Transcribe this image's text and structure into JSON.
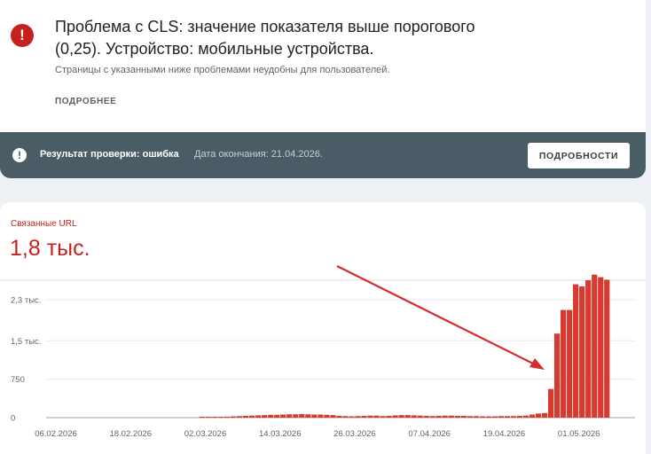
{
  "issue": {
    "title": "Проблема с CLS: значение показателя выше порогового (0,25). Устройство: мобильные устройства.",
    "description": "Страницы с указанными ниже проблемами неудобны для пользователей.",
    "more_link": "ПОДРОБНЕЕ",
    "icon": "error-icon"
  },
  "status": {
    "result": "Результат проверки: ошибка",
    "end_date": "Дата окончания: 21.04.2026.",
    "details_button": "ПОДРОБНОСТИ",
    "icon": "info-icon"
  },
  "metric": {
    "label": "Связанные URL",
    "value": "1,8 тыс."
  },
  "colors": {
    "accent": "#c5221f",
    "bar": "#d93a2f",
    "status_bar": "#4a5d66"
  },
  "chart_data": {
    "type": "bar",
    "title": "",
    "xlabel": "",
    "ylabel": "",
    "ylim": [
      0,
      2300
    ],
    "yticks": [
      0,
      750,
      1500,
      2300
    ],
    "ytick_labels": [
      "0",
      "750",
      "1,5 тыс.",
      "2,3 тыс."
    ],
    "x_start": "2026-02-06",
    "x_end": "2026-05-09",
    "xtick_labels": [
      "06.02.2026",
      "18.02.2026",
      "02.03.2026",
      "14.03.2026",
      "26.03.2026",
      "07.04.2026",
      "19.04.2026",
      "01.05.2026"
    ],
    "grid": true,
    "annotation": "red arrow pointing to spike",
    "series": [
      {
        "values": [
          {
            "x": "2026-02-06",
            "y": 0
          },
          {
            "x": "2026-02-07",
            "y": 0
          },
          {
            "x": "2026-02-08",
            "y": 0
          },
          {
            "x": "2026-02-09",
            "y": 0
          },
          {
            "x": "2026-02-10",
            "y": 0
          },
          {
            "x": "2026-02-11",
            "y": 0
          },
          {
            "x": "2026-02-12",
            "y": 0
          },
          {
            "x": "2026-02-13",
            "y": 0
          },
          {
            "x": "2026-02-14",
            "y": 0
          },
          {
            "x": "2026-02-15",
            "y": 0
          },
          {
            "x": "2026-02-16",
            "y": 0
          },
          {
            "x": "2026-02-17",
            "y": 0
          },
          {
            "x": "2026-02-18",
            "y": 0
          },
          {
            "x": "2026-02-19",
            "y": 0
          },
          {
            "x": "2026-02-20",
            "y": 0
          },
          {
            "x": "2026-02-21",
            "y": 0
          },
          {
            "x": "2026-02-22",
            "y": 0
          },
          {
            "x": "2026-02-23",
            "y": 0
          },
          {
            "x": "2026-02-24",
            "y": 0
          },
          {
            "x": "2026-02-25",
            "y": 0
          },
          {
            "x": "2026-02-26",
            "y": 0
          },
          {
            "x": "2026-02-27",
            "y": 0
          },
          {
            "x": "2026-02-28",
            "y": 0
          },
          {
            "x": "2026-03-01",
            "y": 5
          },
          {
            "x": "2026-03-02",
            "y": 10
          },
          {
            "x": "2026-03-03",
            "y": 10
          },
          {
            "x": "2026-03-04",
            "y": 15
          },
          {
            "x": "2026-03-05",
            "y": 20
          },
          {
            "x": "2026-03-06",
            "y": 25
          },
          {
            "x": "2026-03-07",
            "y": 30
          },
          {
            "x": "2026-03-08",
            "y": 35
          },
          {
            "x": "2026-03-09",
            "y": 40
          },
          {
            "x": "2026-03-10",
            "y": 45
          },
          {
            "x": "2026-03-11",
            "y": 50
          },
          {
            "x": "2026-03-12",
            "y": 55
          },
          {
            "x": "2026-03-13",
            "y": 55
          },
          {
            "x": "2026-03-14",
            "y": 60
          },
          {
            "x": "2026-03-15",
            "y": 65
          },
          {
            "x": "2026-03-16",
            "y": 65
          },
          {
            "x": "2026-03-17",
            "y": 70
          },
          {
            "x": "2026-03-18",
            "y": 65
          },
          {
            "x": "2026-03-19",
            "y": 60
          },
          {
            "x": "2026-03-20",
            "y": 60
          },
          {
            "x": "2026-03-21",
            "y": 55
          },
          {
            "x": "2026-03-22",
            "y": 50
          },
          {
            "x": "2026-03-23",
            "y": 35
          },
          {
            "x": "2026-03-24",
            "y": 30
          },
          {
            "x": "2026-03-25",
            "y": 25
          },
          {
            "x": "2026-03-26",
            "y": 30
          },
          {
            "x": "2026-03-27",
            "y": 35
          },
          {
            "x": "2026-03-28",
            "y": 40
          },
          {
            "x": "2026-03-29",
            "y": 40
          },
          {
            "x": "2026-03-30",
            "y": 30
          },
          {
            "x": "2026-03-31",
            "y": 35
          },
          {
            "x": "2026-04-01",
            "y": 45
          },
          {
            "x": "2026-04-02",
            "y": 50
          },
          {
            "x": "2026-04-03",
            "y": 50
          },
          {
            "x": "2026-04-04",
            "y": 45
          },
          {
            "x": "2026-04-05",
            "y": 40
          },
          {
            "x": "2026-04-06",
            "y": 35
          },
          {
            "x": "2026-04-07",
            "y": 30
          },
          {
            "x": "2026-04-08",
            "y": 35
          },
          {
            "x": "2026-04-09",
            "y": 40
          },
          {
            "x": "2026-04-10",
            "y": 40
          },
          {
            "x": "2026-04-11",
            "y": 35
          },
          {
            "x": "2026-04-12",
            "y": 35
          },
          {
            "x": "2026-04-13",
            "y": 30
          },
          {
            "x": "2026-04-14",
            "y": 30
          },
          {
            "x": "2026-04-15",
            "y": 25
          },
          {
            "x": "2026-04-16",
            "y": 25
          },
          {
            "x": "2026-04-17",
            "y": 25
          },
          {
            "x": "2026-04-18",
            "y": 30
          },
          {
            "x": "2026-04-19",
            "y": 30
          },
          {
            "x": "2026-04-20",
            "y": 30
          },
          {
            "x": "2026-04-21",
            "y": 35
          },
          {
            "x": "2026-04-22",
            "y": 40
          },
          {
            "x": "2026-04-23",
            "y": 60
          },
          {
            "x": "2026-04-24",
            "y": 80
          },
          {
            "x": "2026-04-25",
            "y": 90
          },
          {
            "x": "2026-04-26",
            "y": 560
          },
          {
            "x": "2026-04-27",
            "y": 1640
          },
          {
            "x": "2026-04-28",
            "y": 2100
          },
          {
            "x": "2026-04-29",
            "y": 2100
          },
          {
            "x": "2026-04-30",
            "y": 2600
          },
          {
            "x": "2026-05-01",
            "y": 2560
          },
          {
            "x": "2026-05-02",
            "y": 2680
          },
          {
            "x": "2026-05-03",
            "y": 2790
          },
          {
            "x": "2026-05-04",
            "y": 2740
          },
          {
            "x": "2026-05-05",
            "y": 2690
          }
        ]
      }
    ]
  }
}
